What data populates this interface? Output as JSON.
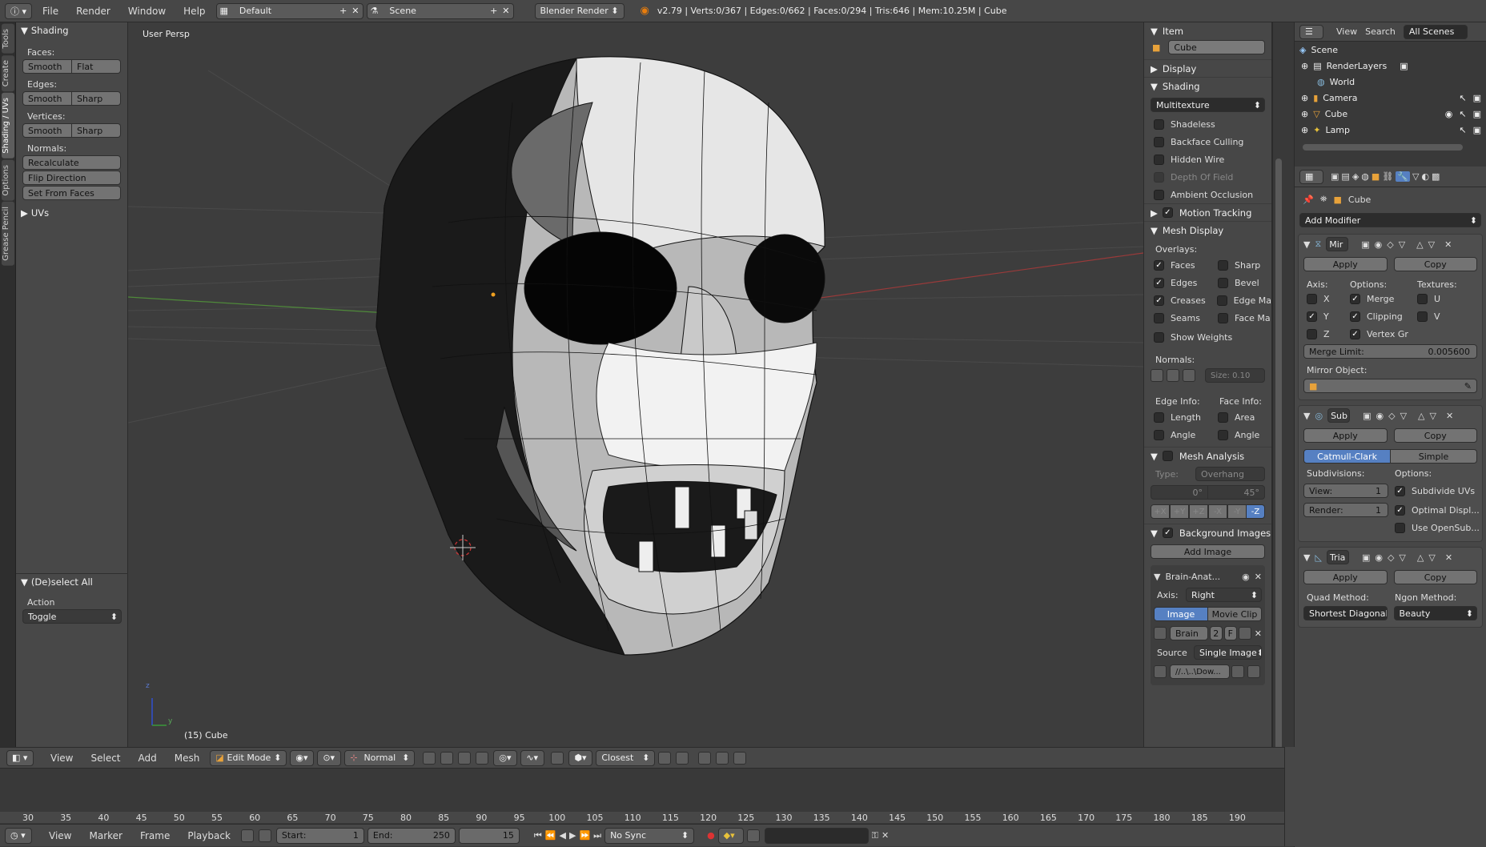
{
  "topbar": {
    "menus": [
      "File",
      "Render",
      "Window",
      "Help"
    ],
    "layout": "Default",
    "scene": "Scene",
    "engine": "Blender Render",
    "stats": "v2.79 | Verts:0/367 | Edges:0/662 | Faces:0/294 | Tris:646 | Mem:10.25M | Cube"
  },
  "vtabs": [
    "Tools",
    "Create",
    "Shading / UVs",
    "Options",
    "Grease Pencil"
  ],
  "toolshelf": {
    "shading_title": "Shading",
    "faces_label": "Faces:",
    "edges_label": "Edges:",
    "vertices_label": "Vertices:",
    "smooth": "Smooth",
    "flat": "Flat",
    "sharp": "Sharp",
    "normals_label": "Normals:",
    "recalculate": "Recalculate",
    "flip_direction": "Flip Direction",
    "set_from_faces": "Set From Faces",
    "uvs_title": "UVs",
    "deselect_title": "(De)select All",
    "action_label": "Action",
    "action_value": "Toggle"
  },
  "viewport": {
    "view_name": "User Persp",
    "object_label": "(15) Cube",
    "axis_y": "y",
    "axis_z": "z"
  },
  "props": {
    "item_title": "Item",
    "item_name": "Cube",
    "display": "Display",
    "shading": "Shading",
    "shading_mode": "Multitexture",
    "shadeless": "Shadeless",
    "backface": "Backface Culling",
    "hidden_wire": "Hidden Wire",
    "dof": "Depth Of Field",
    "ao": "Ambient Occlusion",
    "motion_tracking": "Motion Tracking",
    "mesh_display": "Mesh Display",
    "overlays": "Overlays:",
    "faces": "Faces",
    "sharp": "Sharp",
    "edges": "Edges",
    "bevel": "Bevel",
    "creases": "Creases",
    "edge_ma": "Edge Ma",
    "seams": "Seams",
    "face_ma": "Face Ma",
    "show_weights": "Show Weights",
    "normals": "Normals:",
    "size": "Size:",
    "size_val": "0.10",
    "edge_info": "Edge Info:",
    "face_info": "Face Info:",
    "length": "Length",
    "area": "Area",
    "angle": "Angle",
    "mesh_analysis": "Mesh Analysis",
    "type": "Type:",
    "overhang": "Overhang",
    "deg0": "0°",
    "deg45": "45°",
    "axes": [
      "+X",
      "+Y",
      "+Z",
      "-X",
      "-Y",
      "-Z"
    ],
    "bg_images": "Background Images",
    "add_image": "Add Image",
    "brain": "Brain-Anat...",
    "axis": "Axis:",
    "axis_val": "Right",
    "image": "Image",
    "movie_clip": "Movie Clip",
    "brain_short": "Brain",
    "two": "2",
    "f": "F",
    "source": "Source",
    "source_val": "Single Image",
    "path": "//..\\..\\Dow..."
  },
  "outliner": {
    "view": "View",
    "search": "Search",
    "all_scenes": "All Scenes",
    "items": [
      "Scene",
      "RenderLayers",
      "World",
      "Camera",
      "Cube",
      "Lamp"
    ]
  },
  "modifiers": {
    "breadcrumb": "Cube",
    "add_modifier": "Add Modifier",
    "mirror": {
      "name": "Mir",
      "apply": "Apply",
      "copy": "Copy",
      "axis": "Axis:",
      "options": "Options:",
      "textures": "Textures:",
      "x": "X",
      "y": "Y",
      "z": "Z",
      "merge": "Merge",
      "clipping": "Clipping",
      "vertex_gr": "Vertex Gr",
      "u": "U",
      "v": "V",
      "merge_limit": "Merge Limit:",
      "merge_limit_val": "0.005600",
      "mirror_object": "Mirror Object:"
    },
    "subsurf": {
      "name": "Sub",
      "apply": "Apply",
      "copy": "Copy",
      "catmull": "Catmull-Clark",
      "simple": "Simple",
      "subdivisions": "Subdivisions:",
      "options": "Options:",
      "view": "View:",
      "view_val": "1",
      "render": "Render:",
      "render_val": "1",
      "subdivide_uvs": "Subdivide UVs",
      "optimal": "Optimal Displ...",
      "opensub": "Use OpenSub..."
    },
    "tri": {
      "name": "Tria",
      "apply": "Apply",
      "copy": "Copy",
      "quad": "Quad Method:",
      "ngon": "Ngon Method:",
      "quad_val": "Shortest Diagonal",
      "ngon_val": "Beauty"
    }
  },
  "vheader": {
    "view": "View",
    "select": "Select",
    "add": "Add",
    "mesh": "Mesh",
    "mode": "Edit Mode",
    "pivot": "Normal",
    "snap": "Closest"
  },
  "timeline": {
    "ticks": [
      "30",
      "35",
      "40",
      "45",
      "50",
      "55",
      "60",
      "65",
      "70",
      "75",
      "80",
      "85",
      "90",
      "95",
      "100",
      "105",
      "110",
      "115",
      "120",
      "125",
      "130",
      "135",
      "140",
      "145",
      "150",
      "155",
      "160",
      "165",
      "170",
      "175",
      "180",
      "185",
      "190"
    ],
    "view": "View",
    "marker": "Marker",
    "frame": "Frame",
    "playback": "Playback",
    "start": "Start:",
    "start_val": "1",
    "end": "End:",
    "end_val": "250",
    "current": "15",
    "sync": "No Sync"
  }
}
